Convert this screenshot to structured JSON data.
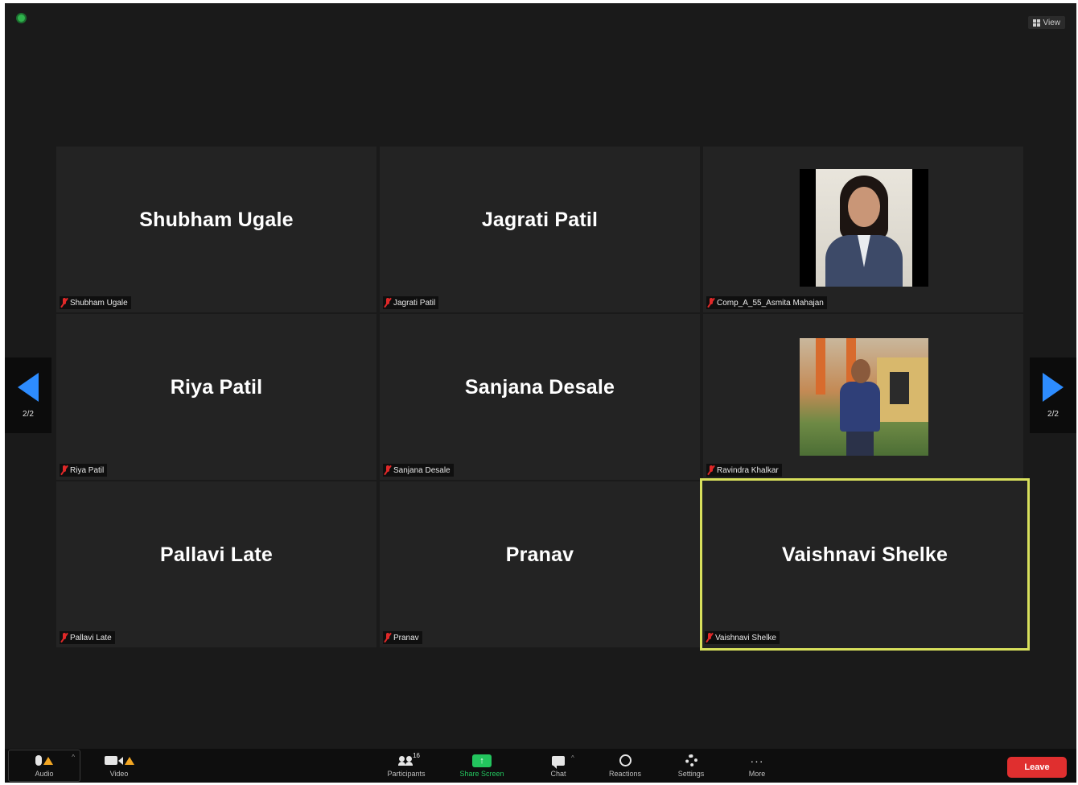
{
  "window": {
    "view_label": "View"
  },
  "paging": {
    "left_page": "2/2",
    "right_page": "2/2"
  },
  "tiles": [
    {
      "display_name": "Shubham Ugale",
      "label": "Shubham Ugale",
      "muted": true,
      "video": false
    },
    {
      "display_name": "Jagrati Patil",
      "label": "Jagrati Patil",
      "muted": true,
      "video": false
    },
    {
      "display_name": "",
      "label": "Comp_A_55_Asmita Mahajan",
      "muted": true,
      "video": true
    },
    {
      "display_name": "Riya Patil",
      "label": "Riya Patil",
      "muted": true,
      "video": false
    },
    {
      "display_name": "Sanjana Desale",
      "label": "Sanjana Desale",
      "muted": true,
      "video": false
    },
    {
      "display_name": "",
      "label": "Ravindra Khalkar",
      "muted": true,
      "video": true
    },
    {
      "display_name": "Pallavi Late",
      "label": "Pallavi Late",
      "muted": true,
      "video": false
    },
    {
      "display_name": "Pranav",
      "label": "Pranav",
      "muted": true,
      "video": false
    },
    {
      "display_name": "Vaishnavi Shelke",
      "label": "Vaishnavi Shelke",
      "muted": true,
      "video": false,
      "active_speaker": true
    }
  ],
  "toolbar": {
    "audio": "Audio",
    "video": "Video",
    "participants": "Participants",
    "participants_count": "16",
    "share_screen": "Share Screen",
    "chat": "Chat",
    "reactions": "Reactions",
    "settings": "Settings",
    "more": "More",
    "leave": "Leave"
  },
  "colors": {
    "accent_blue": "#2d8cff",
    "active_speaker_border": "#d8e05c",
    "share_green": "#23c55e",
    "leave_red": "#e02f2f",
    "muted_red": "#e02828"
  }
}
